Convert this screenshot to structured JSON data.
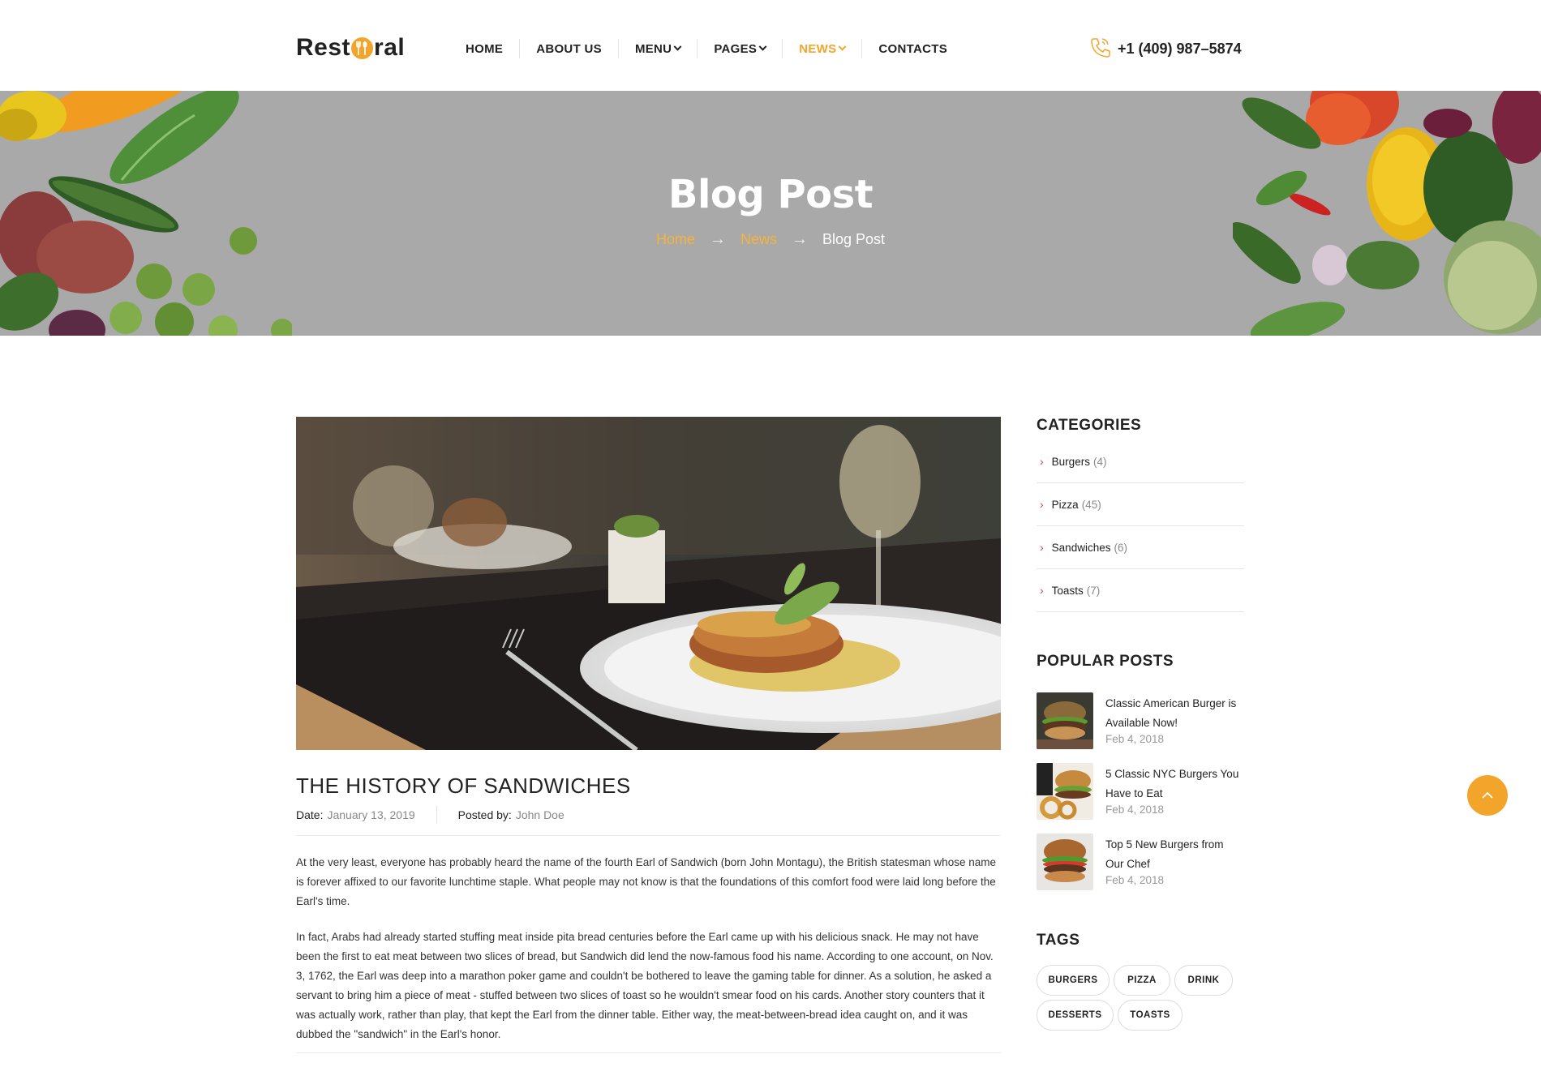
{
  "header": {
    "logo_left": "Rest",
    "logo_right": "ral",
    "phone": "+1 (409) 987–5874",
    "nav": [
      {
        "label": "HOME",
        "dropdown": false
      },
      {
        "label": "ABOUT US",
        "dropdown": false
      },
      {
        "label": "MENU",
        "dropdown": true
      },
      {
        "label": "PAGES",
        "dropdown": true
      },
      {
        "label": "NEWS",
        "dropdown": true,
        "active": true
      },
      {
        "label": "CONTACTS",
        "dropdown": false
      }
    ]
  },
  "hero": {
    "title": "Blog Post",
    "breadcrumb": [
      "Home",
      "News",
      "Blog Post"
    ],
    "arrow": "→"
  },
  "post": {
    "title": "THE HISTORY OF SANDWICHES",
    "date_label": "Date:",
    "date": "January 13, 2019",
    "author_label": "Posted by:",
    "author": "John Doe",
    "paragraphs": [
      "At the very least, everyone has probably heard the name of the fourth Earl of Sandwich (born John Montagu), the British statesman whose name is forever affixed to our favorite lunchtime staple. What people may not know is that the foundations of this comfort food were laid long before the Earl's time.",
      "In fact, Arabs had already started stuffing meat inside pita bread centuries before the Earl came up with his delicious snack. He may not have been the first to eat meat between two slices of bread, but Sandwich did lend the now-famous food his name. According to one account, on Nov. 3, 1762, the Earl was deep into a marathon poker game and couldn't be bothered to leave the gaming table for dinner. As a solution, he asked a servant to bring him a piece of meat - stuffed between two slices of toast so he wouldn't smear food on his cards. Another story counters that it was actually work, rather than play, that kept the Earl from the dinner table. Either way, the meat-between-bread idea caught on, and it was dubbed the \"sandwich\" in the Earl's honor."
    ]
  },
  "sidebar": {
    "categories_title": "CATEGORIES",
    "categories": [
      {
        "name": "Burgers",
        "count": "(4)"
      },
      {
        "name": "Pizza",
        "count": "(45)"
      },
      {
        "name": "Sandwiches",
        "count": "(6)"
      },
      {
        "name": "Toasts",
        "count": "(7)"
      }
    ],
    "popular_title": "POPULAR POSTS",
    "popular": [
      {
        "title": "Classic American Burger is Available Now!",
        "date": "Feb 4, 2018"
      },
      {
        "title": "5 Classic NYC Burgers You Have to Eat",
        "date": "Feb 4, 2018"
      },
      {
        "title": "Top 5 New Burgers from Our Chef",
        "date": "Feb 4, 2018"
      }
    ],
    "tags_title": "TAGS",
    "tags": [
      "BURGERS",
      "PIZZA",
      "DRINK",
      "DESSERTS",
      "TOASTS"
    ]
  },
  "colors": {
    "accent": "#f3a52b",
    "hero_bg": "#a9a9a9",
    "category_arrow": "#e23b3b"
  },
  "icons": {
    "phone": "phone-icon",
    "scroll_top": "chevron-up-icon",
    "category_bullet": "chevron-right-icon"
  }
}
